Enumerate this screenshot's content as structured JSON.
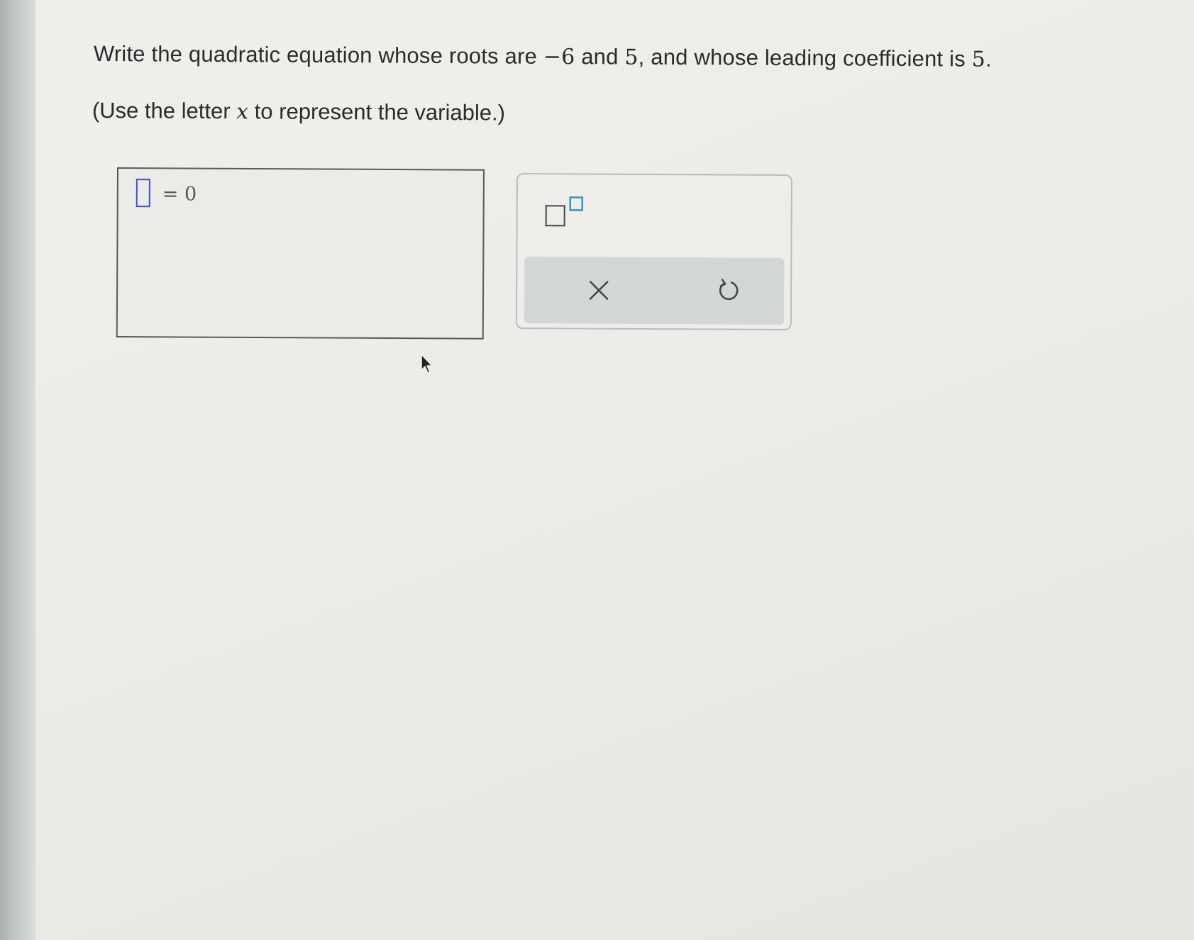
{
  "question": {
    "prefix": "Write the quadratic equation whose roots are ",
    "root1": "−6",
    "middle1": " and ",
    "root2": "5",
    "middle2": ", and whose leading coefficient is ",
    "coefficient": "5",
    "suffix": "."
  },
  "instruction": {
    "prefix": "(Use the letter ",
    "variable": "x",
    "suffix": " to represent the variable.)"
  },
  "answer": {
    "input_value": "",
    "equals": "= 0"
  },
  "toolbar": {
    "exponent_icon": "exponent-template-icon",
    "clear_icon": "close-icon",
    "undo_icon": "undo-icon"
  },
  "colors": {
    "placeholder_border": "#3f4fd0",
    "exponent_accent": "#2f93c4",
    "text": "#2b2b2b"
  }
}
